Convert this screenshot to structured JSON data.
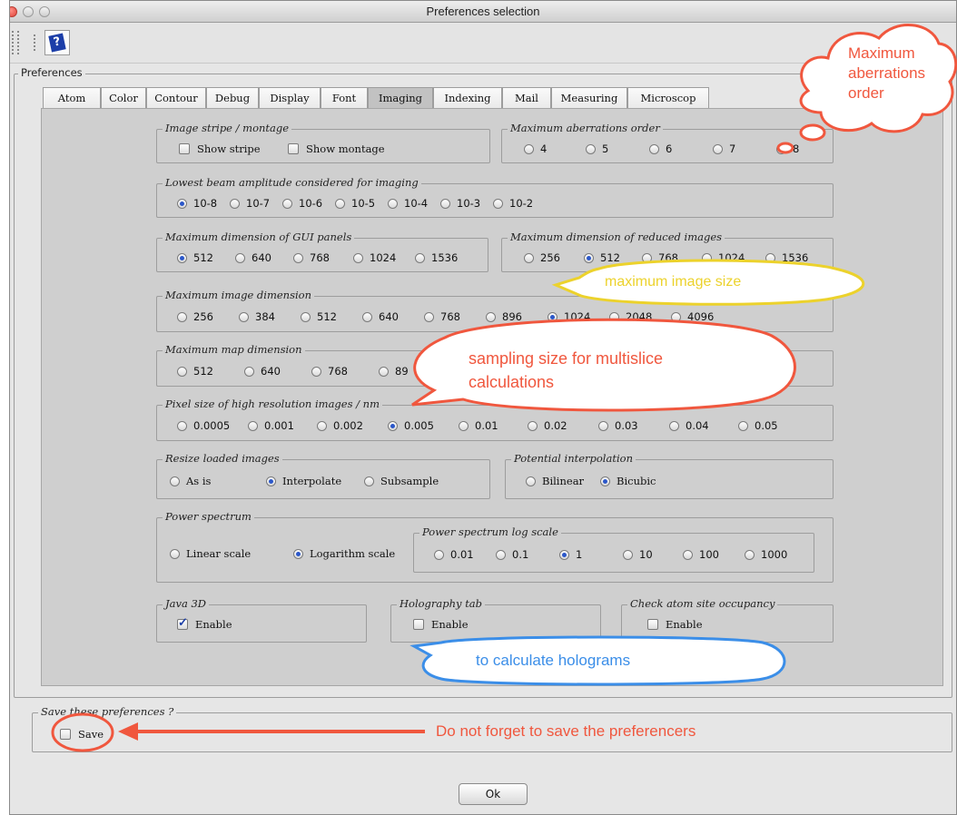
{
  "window": {
    "title": "Preferences selection"
  },
  "preferences_label": "Preferences",
  "tabs": [
    {
      "label": "Atom",
      "active": false
    },
    {
      "label": "Color",
      "active": false
    },
    {
      "label": "Contour",
      "active": false
    },
    {
      "label": "Debug",
      "active": false
    },
    {
      "label": "Display",
      "active": false
    },
    {
      "label": "Font",
      "active": false
    },
    {
      "label": "Imaging",
      "active": true
    },
    {
      "label": "Indexing",
      "active": false
    },
    {
      "label": "Mail",
      "active": false
    },
    {
      "label": "Measuring",
      "active": false
    },
    {
      "label": "Microscop",
      "active": false
    }
  ],
  "groups": {
    "stripe": {
      "title": "Image stripe / montage",
      "options": [
        "Show stripe",
        "Show montage"
      ]
    },
    "aberrations": {
      "title": "Maximum aberrations order",
      "options": [
        "4",
        "5",
        "6",
        "7",
        "8"
      ],
      "selected": "8"
    },
    "beam": {
      "title": "Lowest beam amplitude considered for imaging",
      "options": [
        "10-8",
        "10-7",
        "10-6",
        "10-5",
        "10-4",
        "10-3",
        "10-2"
      ],
      "selected": "10-8"
    },
    "gui": {
      "title": "Maximum dimension of GUI panels",
      "options": [
        "512",
        "640",
        "768",
        "1024",
        "1536"
      ],
      "selected": "512"
    },
    "reduced": {
      "title": "Maximum dimension of reduced images",
      "options": [
        "256",
        "512",
        "768",
        "1024",
        "1536"
      ],
      "selected": "512"
    },
    "image_dim": {
      "title": "Maximum image dimension",
      "options": [
        "256",
        "384",
        "512",
        "640",
        "768",
        "896",
        "1024",
        "2048",
        "4096"
      ],
      "selected": "1024"
    },
    "map_dim": {
      "title": "Maximum map dimension",
      "options": [
        "512",
        "640",
        "768",
        "89"
      ],
      "selected": ""
    },
    "pixel": {
      "title": "Pixel size of high resolution images / nm",
      "options": [
        "0.0005",
        "0.001",
        "0.002",
        "0.005",
        "0.01",
        "0.02",
        "0.03",
        "0.04",
        "0.05"
      ],
      "selected": "0.005"
    },
    "resize": {
      "title": "Resize loaded images",
      "options": [
        "As is",
        "Interpolate",
        "Subsample"
      ],
      "selected": "Interpolate"
    },
    "interp": {
      "title": "Potential interpolation",
      "options": [
        "Bilinear",
        "Bicubic"
      ],
      "selected": "Bicubic"
    },
    "power": {
      "title": "Power spectrum",
      "options": [
        "Linear scale",
        "Logarithm scale"
      ],
      "selected": "Logarithm scale"
    },
    "powerlog": {
      "title": "Power spectrum log scale",
      "options": [
        "0.01",
        "0.1",
        "1",
        "10",
        "100",
        "1000"
      ],
      "selected": "1"
    },
    "java3d": {
      "title": "Java 3D",
      "option": "Enable",
      "checked": true
    },
    "holography": {
      "title": "Holography tab",
      "option": "Enable",
      "checked": false
    },
    "occupancy": {
      "title": "Check atom site occupancy",
      "option": "Enable",
      "checked": false
    }
  },
  "save": {
    "title": "Save these preferences ?",
    "option": "Save",
    "checked": false
  },
  "ok_label": "Ok",
  "annotations": {
    "aberrations": [
      "Maximum",
      "aberrations",
      "order"
    ],
    "image_size": "maximum image size",
    "sampling": [
      "sampling size for multislice",
      "calculations"
    ],
    "holograms": "to calculate holograms",
    "save_reminder": "Do not forget to save the preferencers"
  },
  "colors": {
    "red_callout": "#f0573e",
    "yellow_callout": "#ecd22c",
    "blue_callout": "#3b8ee8"
  }
}
